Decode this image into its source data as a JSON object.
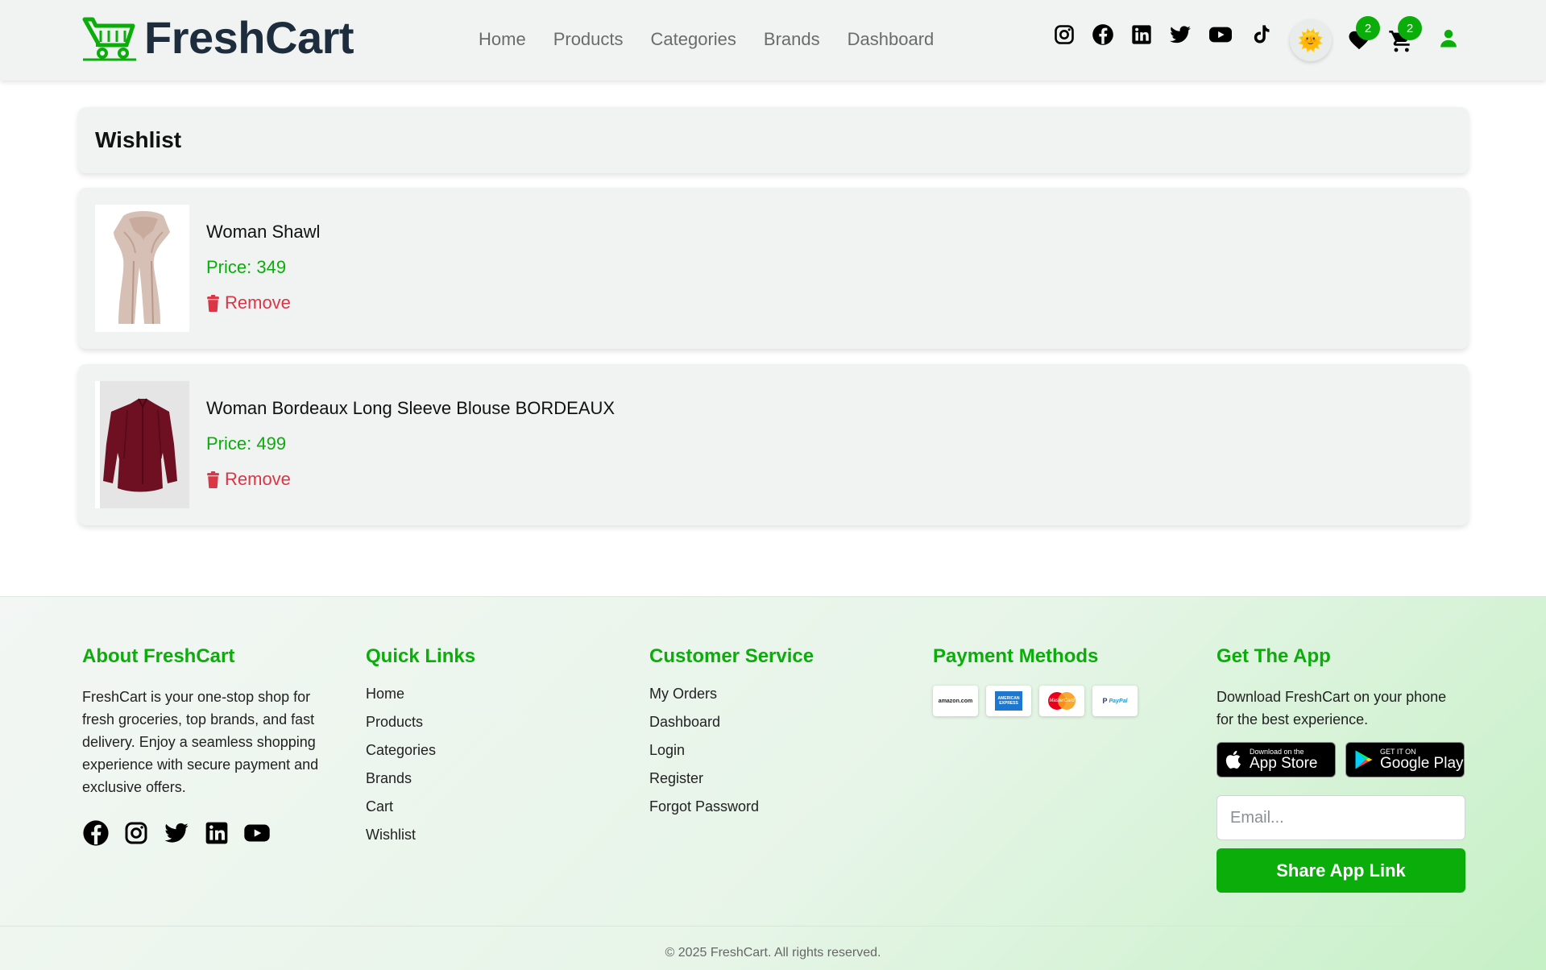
{
  "brand": {
    "name": "FreshCart"
  },
  "nav": {
    "links": [
      "Home",
      "Products",
      "Categories",
      "Brands",
      "Dashboard"
    ],
    "social_icons": [
      "instagram-icon",
      "facebook-icon",
      "linkedin-icon",
      "twitter-icon",
      "youtube-icon",
      "tiktok-icon"
    ],
    "theme_icon": "sun-icon",
    "theme_glyph": "🌞",
    "wishlist_count": "2",
    "cart_count": "2",
    "accent_color": "#0aad0a"
  },
  "wishlist": {
    "title": "Wishlist",
    "items": [
      {
        "name": "Woman Shawl",
        "price": "Price: 349",
        "remove_label": "Remove"
      },
      {
        "name": "Woman Bordeaux Long Sleeve Blouse BORDEAUX",
        "price": "Price: 499",
        "remove_label": "Remove"
      }
    ]
  },
  "footer": {
    "about": {
      "heading": "About FreshCart",
      "text": "FreshCart is your one-stop shop for fresh groceries, top brands, and fast delivery. Enjoy a seamless shopping experience with secure payment and exclusive offers."
    },
    "quick_links": {
      "heading": "Quick Links",
      "links": [
        "Home",
        "Products",
        "Categories",
        "Brands",
        "Cart",
        "Wishlist"
      ]
    },
    "customer_service": {
      "heading": "Customer Service",
      "links": [
        "My Orders",
        "Dashboard",
        "Login",
        "Register",
        "Forgot Password"
      ]
    },
    "payment": {
      "heading": "Payment Methods",
      "methods": [
        "amazon.com",
        "AMERICAN EXPRESS",
        "MasterCard",
        "PayPal"
      ]
    },
    "app": {
      "heading": "Get The App",
      "text": "Download FreshCart on your phone for the best experience.",
      "appstore_small": "Download on the",
      "appstore_big": "App Store",
      "googleplay_small": "GET IT ON",
      "googleplay_big": "Google Play",
      "email_placeholder": "Email...",
      "share_label": "Share App Link"
    },
    "copyright": "© 2025 FreshCart. All rights reserved."
  }
}
